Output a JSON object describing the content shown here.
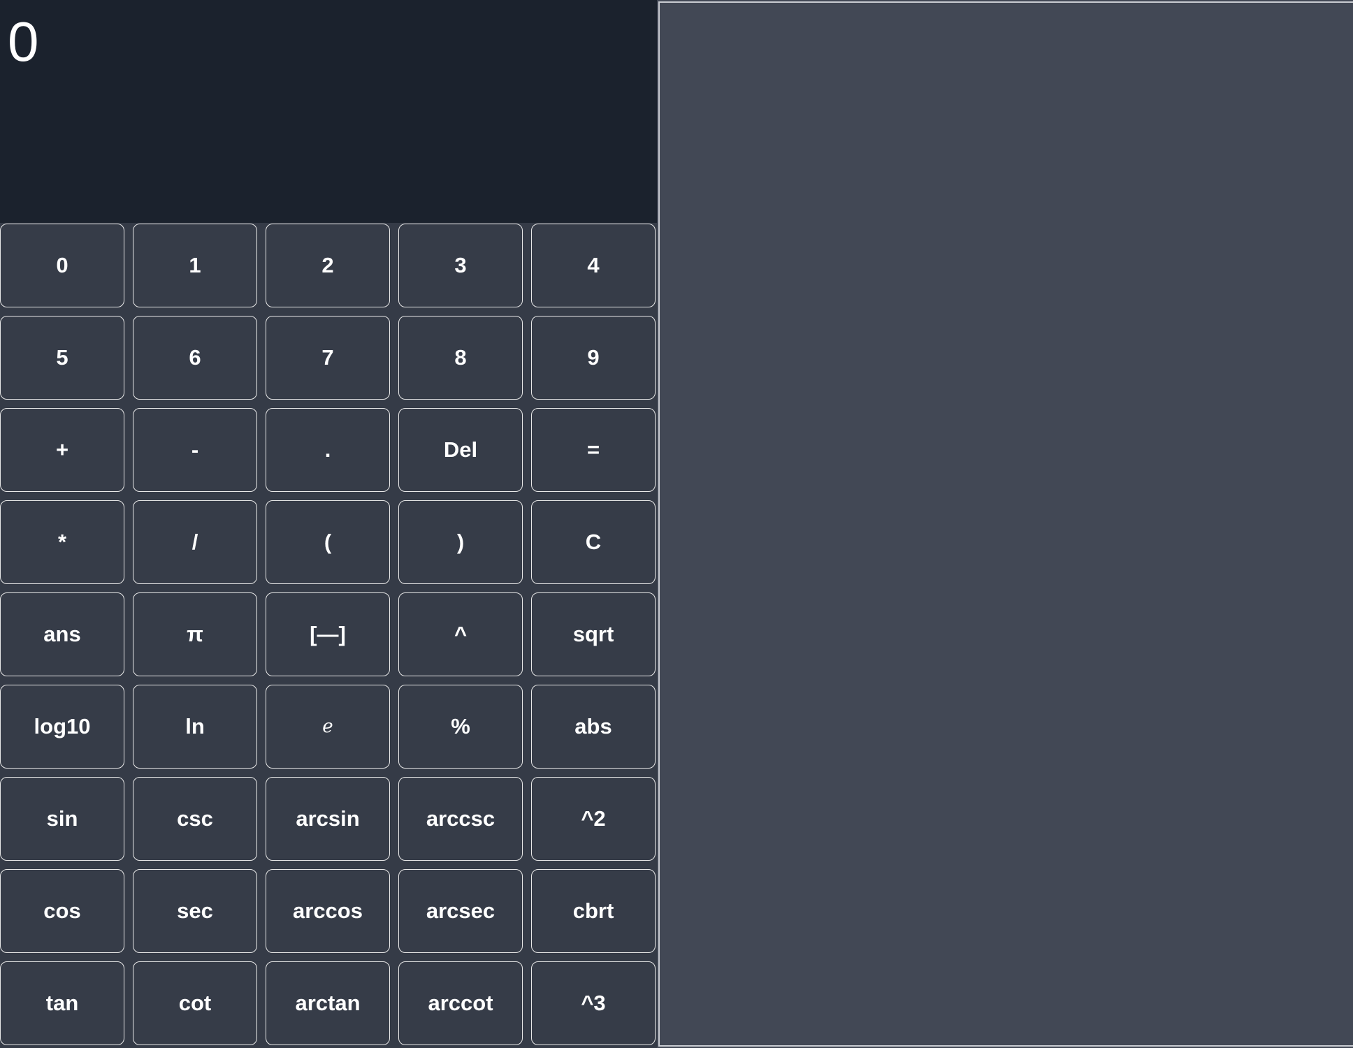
{
  "display": {
    "value": "0"
  },
  "keypad": {
    "rows": [
      [
        {
          "name": "key-0",
          "label": "0"
        },
        {
          "name": "key-1",
          "label": "1"
        },
        {
          "name": "key-2",
          "label": "2"
        },
        {
          "name": "key-3",
          "label": "3"
        },
        {
          "name": "key-4",
          "label": "4"
        }
      ],
      [
        {
          "name": "key-5",
          "label": "5"
        },
        {
          "name": "key-6",
          "label": "6"
        },
        {
          "name": "key-7",
          "label": "7"
        },
        {
          "name": "key-8",
          "label": "8"
        },
        {
          "name": "key-9",
          "label": "9"
        }
      ],
      [
        {
          "name": "plus-button",
          "label": "+"
        },
        {
          "name": "minus-button",
          "label": "-"
        },
        {
          "name": "decimal-point-button",
          "label": "."
        },
        {
          "name": "delete-button",
          "label": "Del"
        },
        {
          "name": "equals-button",
          "label": "="
        }
      ],
      [
        {
          "name": "multiply-button",
          "label": "*"
        },
        {
          "name": "divide-button",
          "label": "/"
        },
        {
          "name": "open-paren-button",
          "label": "("
        },
        {
          "name": "close-paren-button",
          "label": ")"
        },
        {
          "name": "clear-button",
          "label": "C"
        }
      ],
      [
        {
          "name": "ans-button",
          "label": "ans"
        },
        {
          "name": "pi-button",
          "label": "π"
        },
        {
          "name": "fraction-button",
          "label": "[—]"
        },
        {
          "name": "power-button",
          "label": "^"
        },
        {
          "name": "sqrt-button",
          "label": "sqrt"
        }
      ],
      [
        {
          "name": "log10-button",
          "label": "log10"
        },
        {
          "name": "ln-button",
          "label": "ln"
        },
        {
          "name": "euler-e-button",
          "label": "e",
          "style": "italic-serif"
        },
        {
          "name": "percent-button",
          "label": "%"
        },
        {
          "name": "abs-button",
          "label": "abs"
        }
      ],
      [
        {
          "name": "sin-button",
          "label": "sin"
        },
        {
          "name": "csc-button",
          "label": "csc"
        },
        {
          "name": "arcsin-button",
          "label": "arcsin"
        },
        {
          "name": "arccsc-button",
          "label": "arccsc"
        },
        {
          "name": "square-button",
          "label": "^2"
        }
      ],
      [
        {
          "name": "cos-button",
          "label": "cos"
        },
        {
          "name": "sec-button",
          "label": "sec"
        },
        {
          "name": "arccos-button",
          "label": "arccos"
        },
        {
          "name": "arcsec-button",
          "label": "arcsec"
        },
        {
          "name": "cbrt-button",
          "label": "cbrt"
        }
      ],
      [
        {
          "name": "tan-button",
          "label": "tan"
        },
        {
          "name": "cot-button",
          "label": "cot"
        },
        {
          "name": "arctan-button",
          "label": "arctan"
        },
        {
          "name": "arccot-button",
          "label": "arccot"
        },
        {
          "name": "cube-button",
          "label": "^3"
        }
      ]
    ]
  },
  "colors": {
    "display_background": "#1b222d",
    "key_background": "#363c48",
    "key_border": "#e8e8e8",
    "side_panel_background": "#424855",
    "text": "#ffffff"
  }
}
